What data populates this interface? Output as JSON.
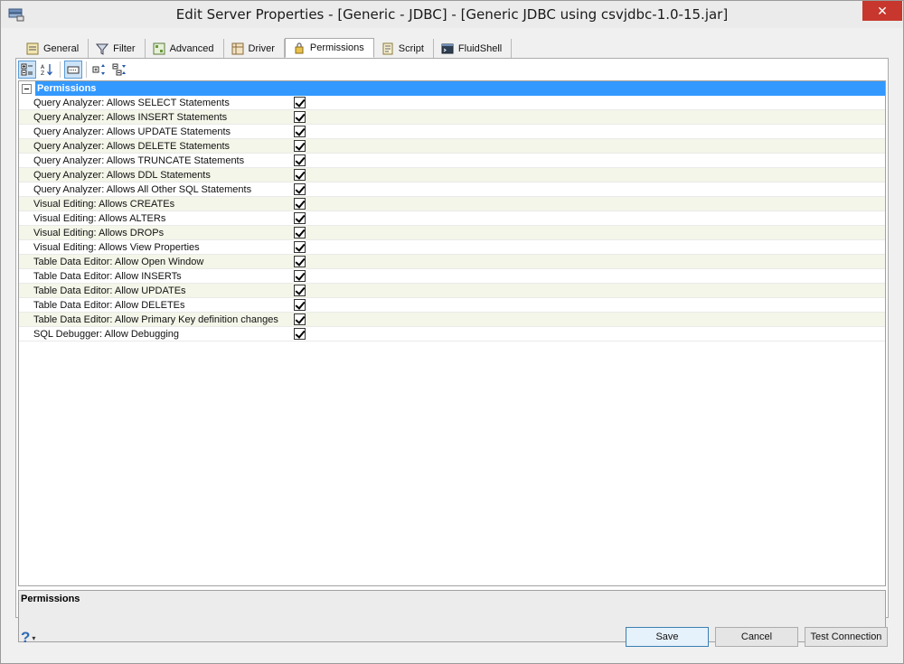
{
  "window": {
    "title": "Edit Server Properties - [Generic - JDBC] - [Generic JDBC using csvjdbc-1.0-15.jar]",
    "close_glyph": "✕"
  },
  "tabs": [
    {
      "label": "General",
      "icon": "general-icon"
    },
    {
      "label": "Filter",
      "icon": "filter-icon"
    },
    {
      "label": "Advanced",
      "icon": "advanced-icon"
    },
    {
      "label": "Driver",
      "icon": "driver-icon"
    },
    {
      "label": "Permissions",
      "icon": "permissions-icon",
      "active": true
    },
    {
      "label": "Script",
      "icon": "script-icon"
    },
    {
      "label": "FluidShell",
      "icon": "fluidshell-icon"
    }
  ],
  "grid": {
    "category": "Permissions",
    "rows": [
      {
        "label": "Query Analyzer: Allows SELECT Statements",
        "checked": true
      },
      {
        "label": "Query Analyzer: Allows INSERT Statements",
        "checked": true
      },
      {
        "label": "Query Analyzer: Allows UPDATE Statements",
        "checked": true
      },
      {
        "label": "Query Analyzer: Allows DELETE Statements",
        "checked": true
      },
      {
        "label": "Query Analyzer: Allows TRUNCATE Statements",
        "checked": true
      },
      {
        "label": "Query Analyzer: Allows DDL Statements",
        "checked": true
      },
      {
        "label": "Query Analyzer: Allows All Other SQL Statements",
        "checked": true
      },
      {
        "label": "Visual Editing: Allows CREATEs",
        "checked": true
      },
      {
        "label": "Visual Editing: Allows ALTERs",
        "checked": true
      },
      {
        "label": "Visual Editing: Allows DROPs",
        "checked": true
      },
      {
        "label": "Visual Editing: Allows View Properties",
        "checked": true
      },
      {
        "label": "Table Data Editor: Allow Open Window",
        "checked": true
      },
      {
        "label": "Table Data Editor: Allow INSERTs",
        "checked": true
      },
      {
        "label": "Table Data Editor: Allow UPDATEs",
        "checked": true
      },
      {
        "label": "Table Data Editor: Allow DELETEs",
        "checked": true
      },
      {
        "label": "Table Data Editor: Allow Primary Key definition changes",
        "checked": true
      },
      {
        "label": "SQL Debugger: Allow Debugging",
        "checked": true
      }
    ]
  },
  "description": {
    "title": "Permissions"
  },
  "footer": {
    "help_glyph": "?",
    "help_caret": "▾",
    "save_label": "Save",
    "cancel_label": "Cancel",
    "test_label": "Test Connection"
  },
  "colors": {
    "selection": "#3399ff",
    "close": "#c7372d"
  }
}
